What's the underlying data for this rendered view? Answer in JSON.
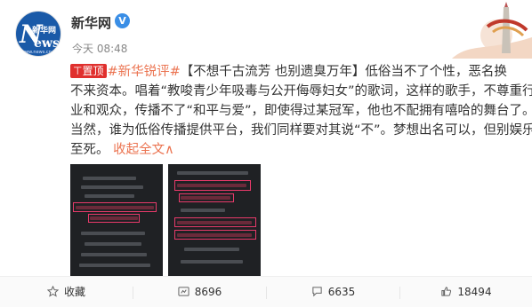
{
  "post": {
    "author": "新华网",
    "verified": "V",
    "time": "今天 08:48",
    "pin_label": "置顶",
    "topic": "#新华锐评#",
    "line1_rest": "【不想千古流芳 也别遗臭万年】低俗当不了个性，恶名换",
    "line2": "不来资本。唱着“教唆青少年吸毒与公开侮辱妇女”的歌词，这样的歌手，不尊重行",
    "line3": "业和观众，传播不了“和平与爱”，即使得过某冠军，他也不配拥有嘻哈的舞台了。",
    "line4": "当然，谁为低俗传播提供平台，我们同样要对其说“不”。梦想出名可以，但别娱乐",
    "line5": "至死。",
    "expand_label": "收起全文",
    "expand_arrow": "∧"
  },
  "avatar": {
    "letter": "N",
    "chinese": "新华网",
    "letters": "ews",
    "url": "www.news.cn"
  },
  "actions": {
    "favorite_label": "收藏",
    "repost_count": "8696",
    "comment_count": "6635",
    "like_count": "18494"
  },
  "icons": {
    "verified": "verified-badge-icon",
    "favorite": "star-icon",
    "repost": "repost-icon",
    "comment": "comment-icon",
    "like": "thumbs-up-icon"
  },
  "colors": {
    "accent": "#eb7350",
    "pin": "#e0302e",
    "verified": "#3a8ee6",
    "highlight_box": "#e83a6a"
  }
}
